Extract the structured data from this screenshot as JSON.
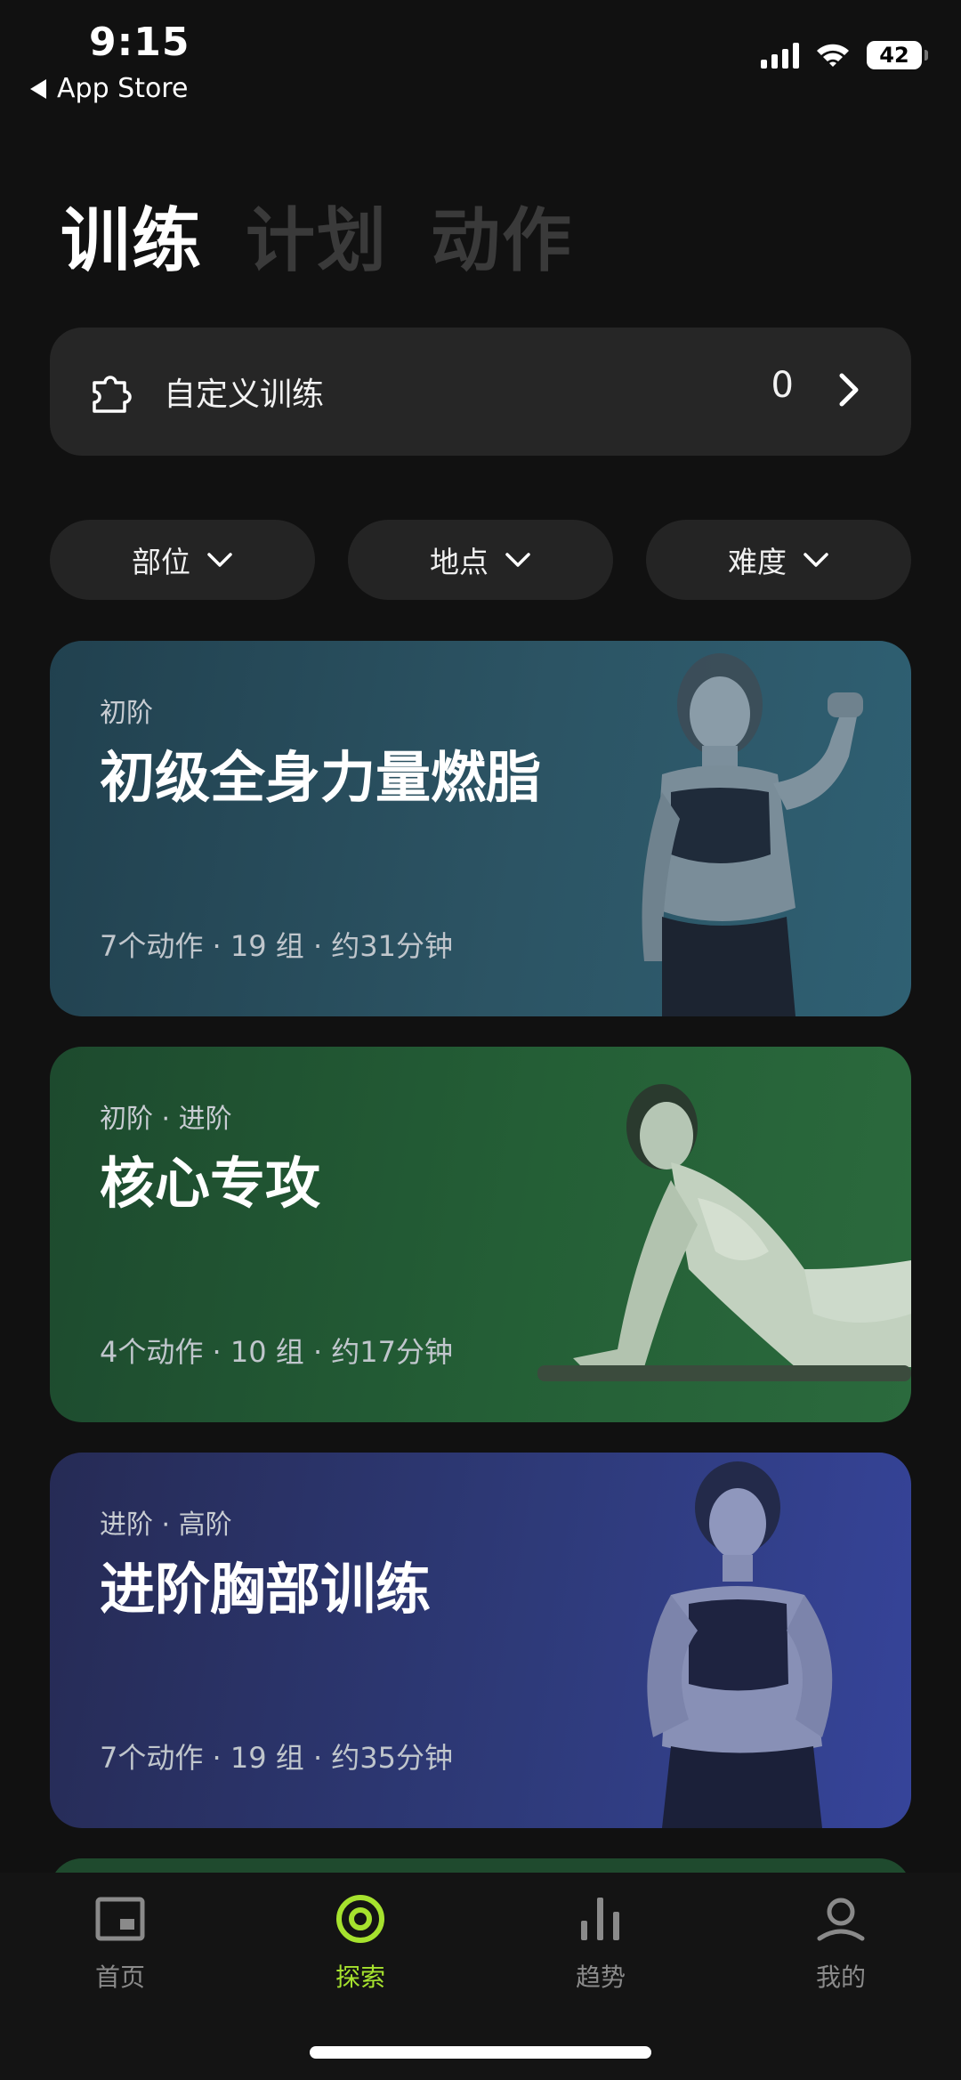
{
  "status_bar": {
    "time": "9:15",
    "back_label": "App Store",
    "battery": "42"
  },
  "tabs": [
    {
      "label": "训练",
      "active": true
    },
    {
      "label": "计划",
      "active": false
    },
    {
      "label": "动作",
      "active": false
    }
  ],
  "custom_training": {
    "label": "自定义训练",
    "count": "0"
  },
  "filters": [
    {
      "label": "部位"
    },
    {
      "label": "地点"
    },
    {
      "label": "难度"
    }
  ],
  "cards": [
    {
      "level": "初阶",
      "title": "初级全身力量燃脂",
      "meta": "7个动作 · 19 组 · 约31分钟"
    },
    {
      "level": "初阶 · 进阶",
      "title": "核心专攻",
      "meta": "4个动作 · 10 组 · 约17分钟"
    },
    {
      "level": "进阶 · 高阶",
      "title": "进阶胸部训练",
      "meta": "7个动作 · 19 组 · 约35分钟"
    }
  ],
  "nav": [
    {
      "label": "首页",
      "icon": "home-icon",
      "active": false
    },
    {
      "label": "探索",
      "icon": "explore-icon",
      "active": true
    },
    {
      "label": "趋势",
      "icon": "trend-icon",
      "active": false
    },
    {
      "label": "我的",
      "icon": "profile-icon",
      "active": false
    }
  ],
  "colors": {
    "accent": "#a6e22e",
    "background": "#111111",
    "inactive_tab": "#3a3a3a"
  }
}
